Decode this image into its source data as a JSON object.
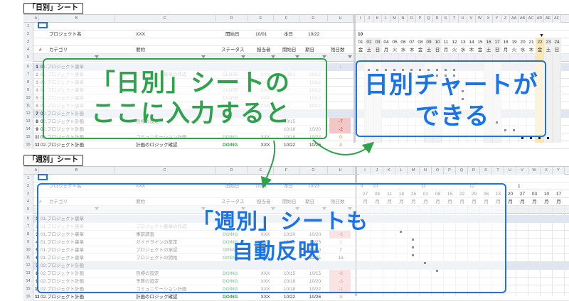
{
  "daily": {
    "tab_label": "「日別」シート",
    "row2": {
      "project_label": "プロジェクト名",
      "project_value": "XXX",
      "start_label": "開始日",
      "start_value": "10/01",
      "today_label": "本日",
      "today_value": "10/22"
    },
    "header": {
      "num": "#",
      "category": "カテゴリ",
      "summary": "要約",
      "status": "ステータス",
      "owner": "担当者",
      "start": "開始日",
      "due": "期日",
      "remaining": "残日数"
    },
    "month": "10",
    "days": [
      "01",
      "02",
      "03",
      "04",
      "05",
      "06",
      "07",
      "08",
      "09",
      "10",
      "11",
      "12",
      "13",
      "14",
      "15",
      "16",
      "17",
      "18",
      "19",
      "20",
      "21",
      "22",
      "23",
      "24"
    ],
    "weekdays": [
      "金",
      "土",
      "日",
      "月",
      "火",
      "水",
      "木",
      "金",
      "土",
      "日",
      "月",
      "火",
      "水",
      "木",
      "金",
      "土",
      "日",
      "月",
      "火",
      "水",
      "木",
      "金",
      "土",
      "日"
    ],
    "rows": [
      {
        "n": "1",
        "cat": "01.プロジェクト裏章",
        "sum": "",
        "st": "",
        "who": "",
        "s": "",
        "d": "",
        "r": "-",
        "type": "sec"
      },
      {
        "n": "2",
        "cat": "01.プロジェクト裏章",
        "sum": "プロジェクト裏章の作成",
        "st": "CLOSE",
        "who": "XXX",
        "s": "10/01",
        "d": "10/12",
        "r": "",
        "type": "done"
      },
      {
        "n": "3",
        "cat": "01.プロジェクト裏章",
        "sum": "",
        "st": "CLOSE",
        "who": "XXX",
        "s": "",
        "d": "10/12",
        "r": "",
        "type": "done"
      },
      {
        "n": "4",
        "cat": "01.プロジェクト裏章",
        "sum": "",
        "st": "CLOSE",
        "who": "XXX",
        "s": "",
        "d": "10/12",
        "r": "",
        "type": "done"
      },
      {
        "n": "5",
        "cat": "01.プロジェクト裏章",
        "sum": "",
        "st": "CLOSE",
        "who": "XXX",
        "s": "",
        "d": "10/12",
        "r": "",
        "type": "done"
      },
      {
        "n": "6",
        "cat": "01.プロジェクト裏章",
        "sum": "",
        "st": "CLOSE",
        "who": "XXX",
        "s": "",
        "d": "10/12",
        "r": "",
        "type": "done"
      },
      {
        "n": "7",
        "cat": "02.プロジェクト計画",
        "sum": "",
        "st": "",
        "who": "",
        "s": "",
        "d": "",
        "r": "",
        "type": "sec"
      },
      {
        "n": "8",
        "cat": "02.プロジェクト計画",
        "sum": "目標の設定",
        "st": "",
        "who": "",
        "s": "10/15",
        "d": "",
        "r": "-7",
        "type": "red"
      },
      {
        "n": "9",
        "cat": "02.プロジェクト計画",
        "sum": "",
        "st": "",
        "who": "",
        "s": "10/18",
        "d": "10/20",
        "r": "-2",
        "type": "red"
      },
      {
        "n": "10",
        "cat": "02.プロジェクト計画",
        "sum": "コミュニケーション計画",
        "st": "DOING",
        "who": "XXX",
        "s": "10/18",
        "d": "10/22",
        "r": "0",
        "type": "doing"
      },
      {
        "n": "11",
        "cat": "02.プロジェクト計画",
        "sum": "計画のロジック確認",
        "st": "DOING",
        "who": "XXX",
        "s": "10/22",
        "d": "10/26",
        "r": "4",
        "type": "doing"
      }
    ],
    "overlay_left": [
      "「日別」シートの",
      "ここに入力すると"
    ],
    "overlay_right": [
      "日別チャートが",
      "できる"
    ]
  },
  "weekly": {
    "tab_label": "「週別」シート",
    "row2": {
      "project_label": "プロジェクト名",
      "project_value": "XXX",
      "start_label": "開始日",
      "start_value": "10/01",
      "today_label": "本日",
      "today_value": "10/23"
    },
    "header": {
      "num": "#",
      "category": "カテゴリ",
      "summary": "要約",
      "status": "ステータス",
      "owner": "担当者",
      "start": "開始日",
      "due": "期日",
      "remaining": "残日数"
    },
    "years": [
      "9",
      "10",
      "",
      "",
      "",
      "11",
      "",
      "",
      "",
      "12",
      "",
      "",
      "",
      "1"
    ],
    "days": [
      "27",
      "04",
      "11",
      "18",
      "25",
      "01",
      "08",
      "15",
      "22",
      "29",
      "06",
      "13",
      "20",
      "27",
      "03",
      "10",
      "17"
    ],
    "weekday": "月",
    "rows": [
      {
        "n": "1",
        "cat": "01.プロジェクト裏章",
        "sum": "",
        "st": "",
        "who": "",
        "s": "",
        "d": "",
        "r": "-",
        "type": "sec"
      },
      {
        "n": "2",
        "cat": "01.プロジェクト裏章",
        "sum": "プロジェクト裏章の作成",
        "st": "",
        "who": "",
        "s": "",
        "d": "",
        "r": "",
        "type": "done"
      },
      {
        "n": "3",
        "cat": "01.プロジェクト裏章",
        "sum": "事前調査",
        "st": "DOING",
        "who": "XXX",
        "s": "10/20",
        "d": "10/20",
        "r": "-3",
        "type": "red"
      },
      {
        "n": "4",
        "cat": "01.プロジェクト裏章",
        "sum": "ガイドラインの策定",
        "st": "DOING",
        "who": "XXX",
        "s": "10/21",
        "d": "10/25",
        "r": "2",
        "type": "doing"
      },
      {
        "n": "5",
        "cat": "01.プロジェクト裏章",
        "sum": "プロジェクトの承認",
        "st": "OPEN",
        "who": "XXX",
        "s": "",
        "d": "10/30",
        "r": "7",
        "type": "open"
      },
      {
        "n": "6",
        "cat": "01.プロジェクト裏章",
        "sum": "プロジェクトの開始",
        "st": "OPEN",
        "who": "XXX",
        "s": "",
        "d": "11/05",
        "r": "13",
        "type": "open"
      },
      {
        "n": "7",
        "cat": "02.プロジェクト計画",
        "sum": "",
        "st": "",
        "who": "",
        "s": "",
        "d": "",
        "r": "",
        "type": "sec"
      },
      {
        "n": "8",
        "cat": "02.プロジェクト計画",
        "sum": "目標の設定",
        "st": "DOING",
        "who": "XXX",
        "s": "10/15",
        "d": "10/15",
        "r": "-8",
        "type": "red"
      },
      {
        "n": "9",
        "cat": "02.プロジェクト計画",
        "sum": "予算の設定",
        "st": "DOING",
        "who": "XXX",
        "s": "10/18",
        "d": "10/20",
        "r": "-3",
        "type": "red"
      },
      {
        "n": "10",
        "cat": "02.プロジェクト計画",
        "sum": "コミュニケーション計画",
        "st": "DOING",
        "who": "XXX",
        "s": "10/18",
        "d": "10/22",
        "r": "-1",
        "type": "red"
      },
      {
        "n": "11",
        "cat": "02.プロジェクト計画",
        "sum": "計画のロジック確認",
        "st": "DOING",
        "who": "XXX",
        "s": "10/22",
        "d": "10/26",
        "r": "3",
        "type": "doing"
      }
    ],
    "overlay": [
      "「週別」シートも",
      "自動反映"
    ]
  },
  "colors": {
    "green": "#2fa24c",
    "blue": "#1a73e8",
    "red": "#c0392b"
  }
}
